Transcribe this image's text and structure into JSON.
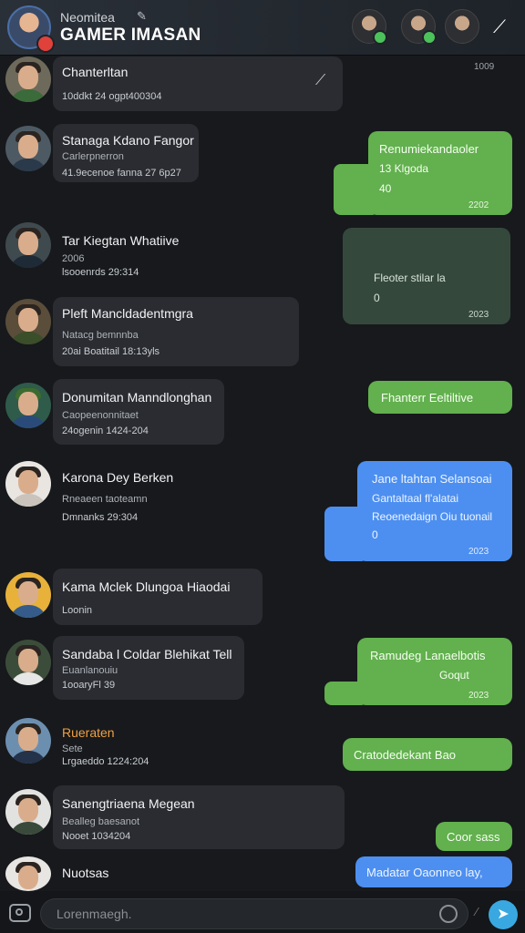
{
  "header": {
    "subtitle": "Neomitea",
    "title": "GAMER IMASAN",
    "edit_icon": "pencil-icon",
    "action_icon": "magic-wand-icon"
  },
  "contacts": [
    {
      "name": "Chanterltan",
      "line1": "",
      "line2": "10ddkt 24 ogpt400304"
    },
    {
      "name": "Stanaga Kdano Fangor",
      "line1": "Carlerpnerron",
      "line2": "41.9ecenoe fanna 27 6p27"
    },
    {
      "name": "Tar Kiegtan Whatiive",
      "line1": "2006",
      "line2": "lsooenrds 29:314"
    },
    {
      "name": "Pleft Mancldadentmgra",
      "line1": "Natacg bemnnba",
      "line2": "20ai Boatitail 18:13yls"
    },
    {
      "name": "Donumitan Manndlonghan",
      "line1": "Caopeenonnitaet",
      "line2": "24ogenin 1424-204"
    },
    {
      "name": "Karona Dey Berken",
      "line1": "Rneaeen taoteamn",
      "line2": "Dmnanks 29:304"
    },
    {
      "name": "Kama Mclek Dlungoa Hiaodai",
      "line1": "",
      "line2": "Loonin"
    },
    {
      "name": "Sandaba l Coldar Blehikat Tell",
      "line1": "Euanlanouiu",
      "line2": "1ooaryFl 39"
    },
    {
      "name": "Rueraten",
      "line1": "Sete",
      "line2": "Lrgaeddo 1224:204"
    },
    {
      "name": "Sanengtriaena Megean",
      "line1": "Bealleg baesanot",
      "line2": "Nooet 1034204"
    },
    {
      "name": "Nuotsas",
      "line1": "",
      "line2": ""
    }
  ],
  "messages": [
    {
      "text": "",
      "time": "1009"
    },
    {
      "text": "Renumiekandaoler",
      "text2": "13 Klgoda",
      "text3": "40",
      "time": "2202"
    },
    {
      "text": "Fleoter stilar la",
      "text2": "0",
      "time": "2023"
    },
    {
      "text": "Fhanterr Eeltiltive",
      "time": ""
    },
    {
      "text": "Jane ltahtan Selansoai",
      "text2": "Gantaltaal fl'alatai",
      "text3": "Reoenedaign Oiu tuonail",
      "text4": "0",
      "time": "2023"
    },
    {
      "text": "Ramudeg Lanaelbotis",
      "text2": "Goqut",
      "time": "2023"
    },
    {
      "text": "Cratodedekant Bao",
      "time": ""
    },
    {
      "text": "Coor sass",
      "time": ""
    },
    {
      "text": "Madatar Oaonneo lay,",
      "time": ""
    }
  ],
  "composer": {
    "placeholder": "Lorenmaegh.",
    "send_icon": "send-icon",
    "camera_icon": "camera-icon"
  },
  "colors": {
    "green": "#62b04e",
    "blue": "#4d8ff0",
    "dark_green": "#35483c",
    "card": "#2a2c31"
  }
}
